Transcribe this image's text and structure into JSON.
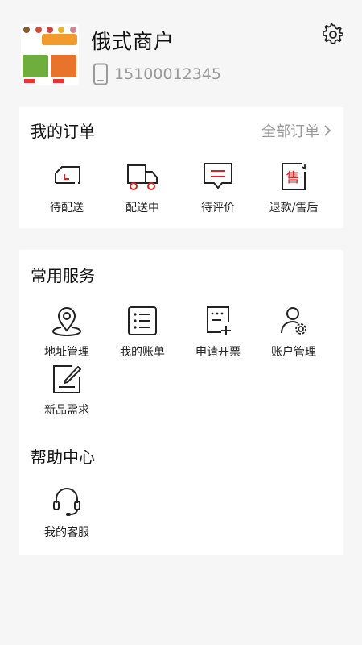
{
  "profile": {
    "shop_name": "俄式商户",
    "phone": "15100012345"
  },
  "orders": {
    "title": "我的订单",
    "all_orders_label": "全部订单",
    "items": [
      {
        "label": "待配送",
        "icon": "delivery-pending-icon"
      },
      {
        "label": "配送中",
        "icon": "truck-icon"
      },
      {
        "label": "待评价",
        "icon": "review-icon"
      },
      {
        "label": "退款/售后",
        "icon": "refund-icon"
      }
    ]
  },
  "services": {
    "title": "常用服务",
    "items": [
      {
        "label": "地址管理",
        "icon": "location-pin-icon"
      },
      {
        "label": "我的账单",
        "icon": "bill-list-icon"
      },
      {
        "label": "申请开票",
        "icon": "invoice-icon"
      },
      {
        "label": "账户管理",
        "icon": "account-settings-icon"
      },
      {
        "label": "新品需求",
        "icon": "edit-note-icon"
      }
    ]
  },
  "help": {
    "title": "帮助中心",
    "items": [
      {
        "label": "我的客服",
        "icon": "headset-icon"
      }
    ]
  },
  "colors": {
    "accent": "#e02020",
    "text": "#222222",
    "muted": "#9a9a9a",
    "background": "#f6f6f6"
  }
}
